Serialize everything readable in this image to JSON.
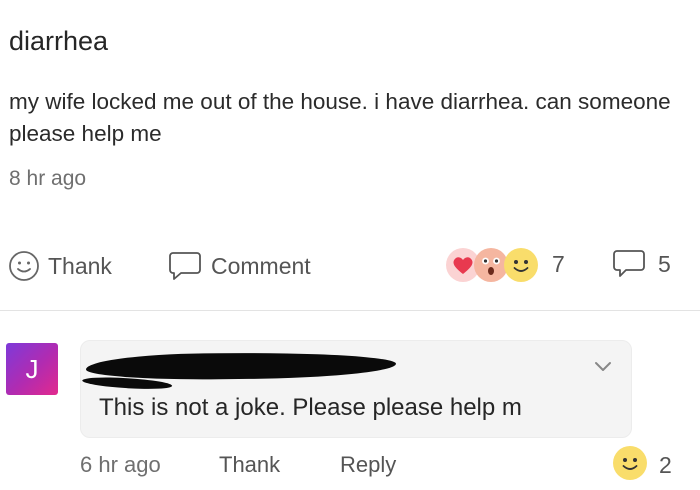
{
  "post": {
    "title": "diarrhea",
    "body": "my wife locked me out of the house. i have diarrhea. can someone please help me",
    "time": "8 hr ago",
    "thank_label": "Thank",
    "comment_label": "Comment",
    "reaction_count": "7",
    "comment_count": "5",
    "reaction_icons": [
      "heart-icon",
      "wow-face-icon",
      "smile-face-icon"
    ]
  },
  "comment": {
    "avatar_letter": "J",
    "author_redacted": true,
    "text": "This is not a joke. Please please help m",
    "time": "6 hr ago",
    "thank_label": "Thank",
    "reply_label": "Reply",
    "reaction_count": "2",
    "reaction_icon": "smile-face-icon"
  },
  "colors": {
    "heart": "#e8394f",
    "avatar_gradient_start": "#7d3ad9",
    "avatar_gradient_end": "#e22a8d",
    "smile": "#f9dd6b"
  }
}
